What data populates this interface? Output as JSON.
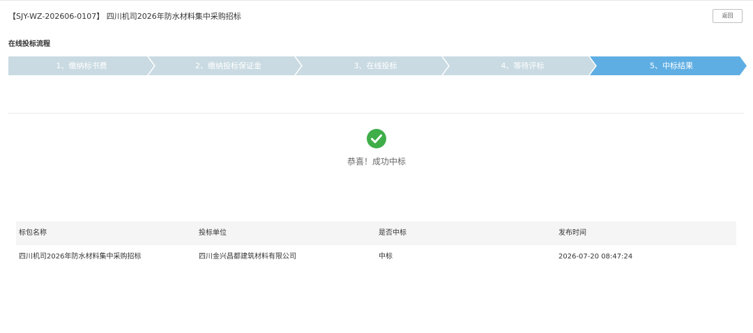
{
  "header": {
    "title": "【SJY-WZ-202606-0107】 四川机司2026年防水材料集中采购招标",
    "back_label": "返回"
  },
  "process": {
    "section_label": "在线投标流程",
    "steps": [
      {
        "label": "1、缴纳标书费",
        "active": false
      },
      {
        "label": "2、缴纳投标保证金",
        "active": false
      },
      {
        "label": "3、在线投标",
        "active": false
      },
      {
        "label": "4、等待评标",
        "active": false
      },
      {
        "label": "5、中标结果",
        "active": true
      }
    ],
    "colors": {
      "inactive": "#c9dae2",
      "active": "#5faee3",
      "separator": "#ffffff"
    }
  },
  "result": {
    "icon": "check-circle-icon",
    "icon_color": "#3fae49",
    "message": "恭喜！成功中标"
  },
  "table": {
    "columns": [
      "标包名称",
      "投标单位",
      "是否中标",
      "发布时间"
    ],
    "rows": [
      [
        "四川机司2026年防水材料集中采购招标",
        "四川金兴昌都建筑材料有限公司",
        "中标",
        "2026-07-20 08:47:24"
      ]
    ]
  }
}
